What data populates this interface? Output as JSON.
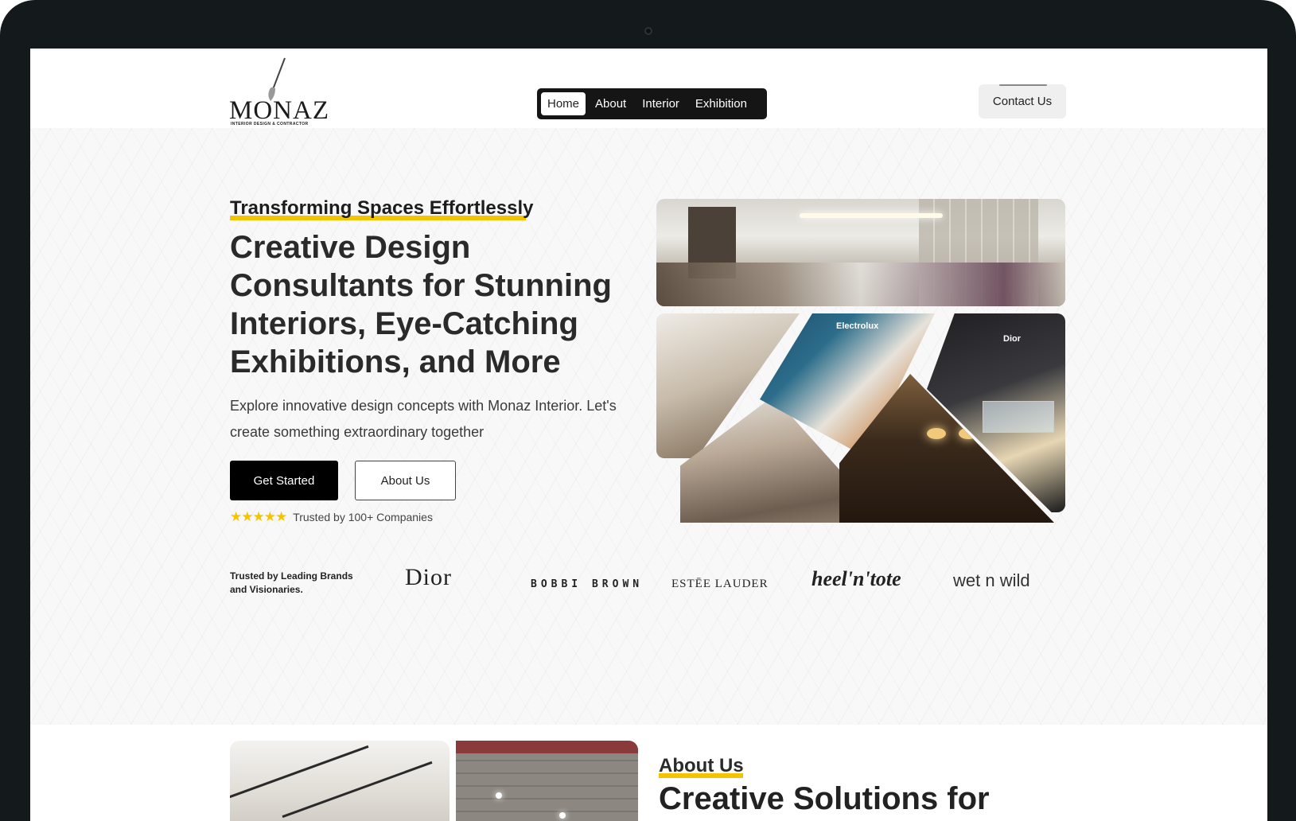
{
  "brand": {
    "logo_text": "MONAZ",
    "logo_subtitle": "INTERIOR DESIGN & CONTRACTOR"
  },
  "nav": {
    "items": [
      {
        "label": "Home",
        "active": true
      },
      {
        "label": "About",
        "active": false
      },
      {
        "label": "Interior",
        "active": false
      },
      {
        "label": "Exhibition",
        "active": false
      }
    ],
    "contact_label": "Contact Us"
  },
  "hero": {
    "tagline": "Transforming Spaces Effortlessly",
    "headline": "Creative Design Consultants for Stunning Interiors, Eye-Catching Exhibitions, and More",
    "subtext": "Explore innovative design concepts with Monaz Interior. Let's create something extraordinary together",
    "primary_button": "Get Started",
    "secondary_button": "About Us",
    "rating_stars": "★★★★★",
    "rating_text": "Trusted by 100+ Companies",
    "collage_text": {
      "electrolux": "Electrolux",
      "dior": "Dior"
    }
  },
  "brands": {
    "label": "Trusted by Leading Brands and Visionaries.",
    "logos": [
      "Dior",
      "BOBBI BROWN",
      "ESTĒE LAUDER",
      "heel'n'tote",
      "wet n wild"
    ]
  },
  "about": {
    "label": "About Us",
    "title": "Creative Solutions for"
  },
  "colors": {
    "accent": "#f5c400",
    "nav_bg": "#151515",
    "device_frame": "#14191b"
  }
}
